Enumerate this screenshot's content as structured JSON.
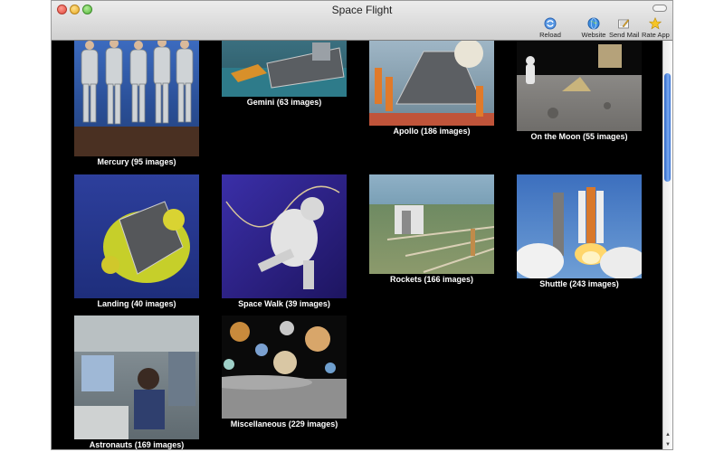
{
  "window": {
    "title": "Space Flight"
  },
  "toolbar": {
    "reload_label": "Reload",
    "website_label": "Website",
    "mail_label": "Send Mail",
    "rate_label": "Rate App"
  },
  "gallery": {
    "items": [
      {
        "caption": "Mercury (95 images)"
      },
      {
        "caption": "Gemini (63 images)"
      },
      {
        "caption": "Apollo (186 images)"
      },
      {
        "caption": "On the Moon (55 images)"
      },
      {
        "caption": "Landing (40 images)"
      },
      {
        "caption": "Space Walk (39 images)"
      },
      {
        "caption": "Rockets (166 images)"
      },
      {
        "caption": "Shuttle (243 images)"
      },
      {
        "caption": "Astronauts (169 images)"
      },
      {
        "caption": "Miscellaneous (229 images)"
      }
    ]
  },
  "icons": {
    "reload": "reload-globe-icon",
    "website": "globe-icon",
    "mail": "send-mail-icon",
    "rate": "star-icon"
  },
  "colors": {
    "background": "#000000",
    "caption": "#ffffff",
    "scroll_thumb": "#3a73d4"
  }
}
